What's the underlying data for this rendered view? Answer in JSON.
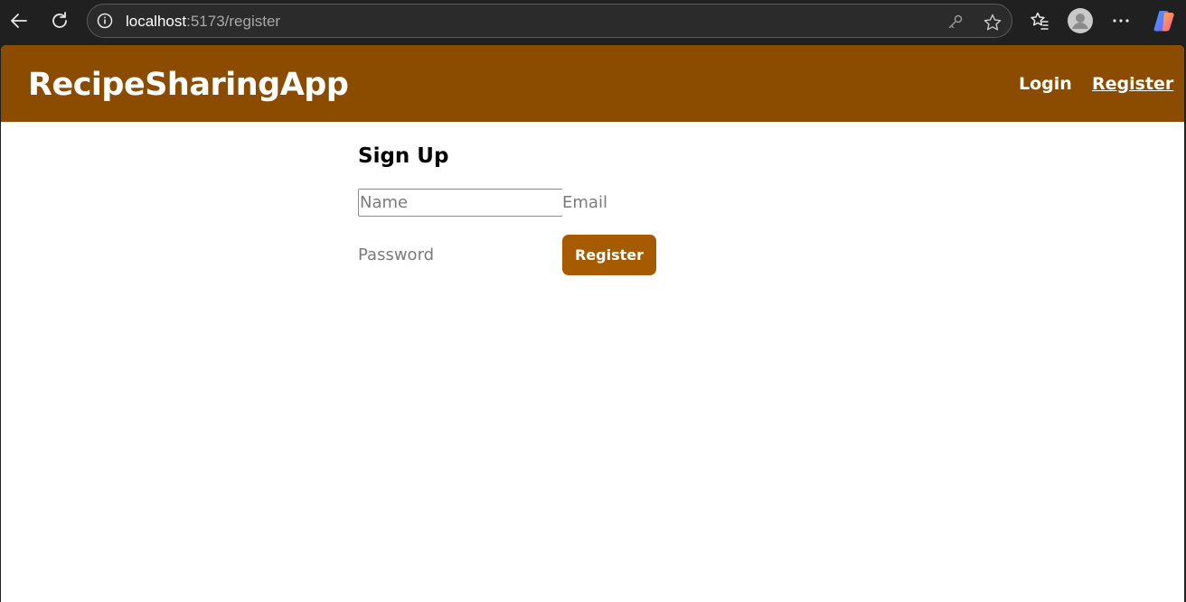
{
  "browser": {
    "url_host": "localhost",
    "url_rest": ":5173/register",
    "icons": [
      "back-arrow-icon",
      "reload-icon",
      "info-icon",
      "key-icon",
      "star-icon",
      "favorites-icon",
      "profile-icon",
      "more-icon",
      "copilot-icon"
    ]
  },
  "app": {
    "brand": "RecipeSharingApp",
    "nav": {
      "login": "Login",
      "register": "Register"
    },
    "header_color": "#8b4c00"
  },
  "form": {
    "title": "Sign Up",
    "name_placeholder": "Name",
    "email_placeholder": "Email",
    "password_placeholder": "Password",
    "submit_label": "Register",
    "button_color": "#a65b00"
  }
}
